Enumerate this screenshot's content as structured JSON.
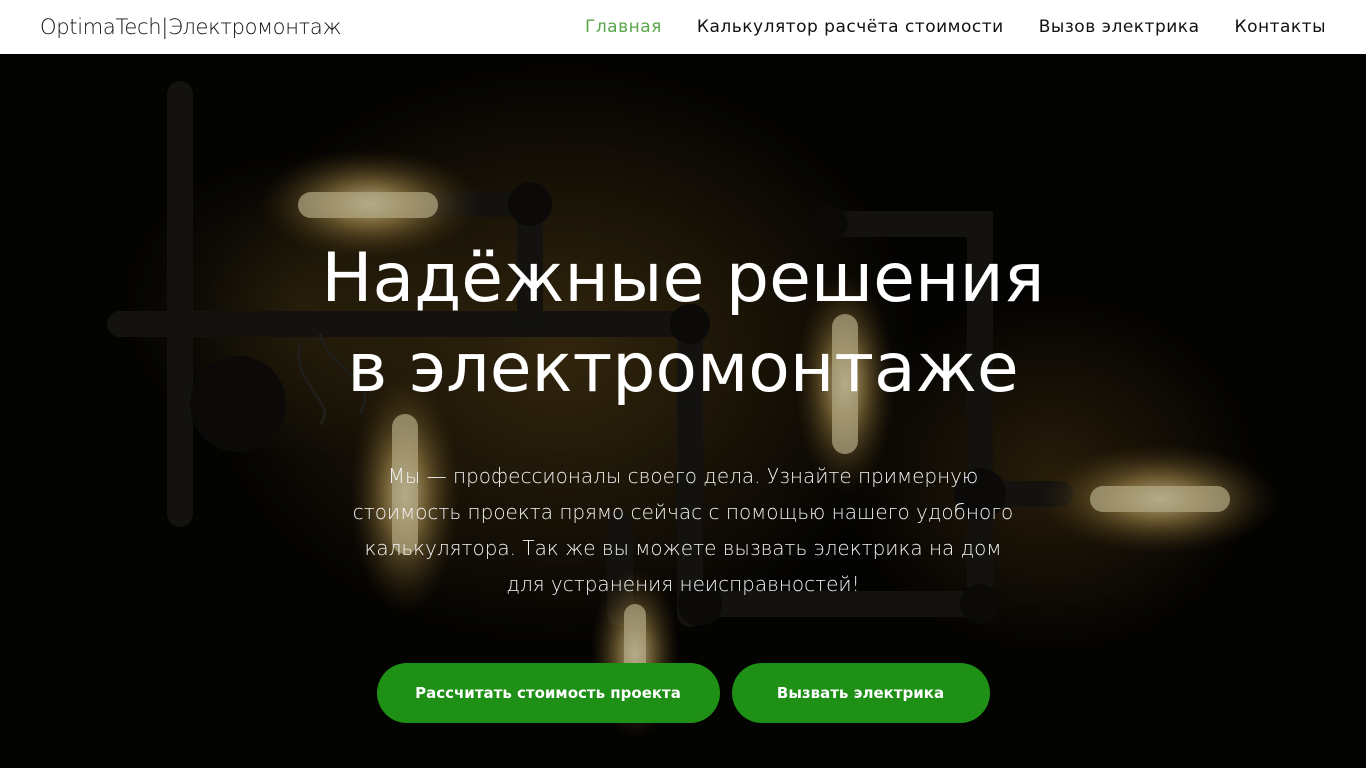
{
  "header": {
    "logo": "OptimaTech|Электромонтаж",
    "nav": [
      {
        "label": "Главная",
        "active": true
      },
      {
        "label": "Калькулятор расчёта стоимости",
        "active": false
      },
      {
        "label": "Вызов электрика",
        "active": false
      },
      {
        "label": "Контакты",
        "active": false
      }
    ]
  },
  "hero": {
    "title": "Надёжные решения в электромонтаже",
    "text": "Мы — профессионалы своего дела. Узнайте примерную стоимость проекта прямо сейчас с помощью нашего удобного калькулятора. Так же вы можете вызвать электрика на дом для устранения неисправностей!",
    "buttons": {
      "calculate": "Рассчитать стоимость проекта",
      "call": "Вызвать электрика"
    }
  },
  "colors": {
    "accent": "#5aa64a",
    "button": "#1e9016"
  }
}
